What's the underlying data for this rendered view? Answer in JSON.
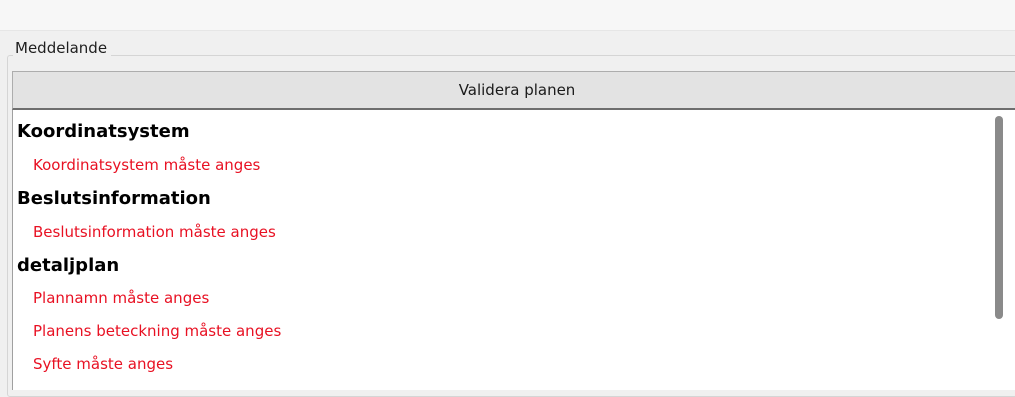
{
  "group": {
    "legend": "Meddelande"
  },
  "toolbar": {
    "validate_label": "Validera planen"
  },
  "messages": {
    "sections": [
      {
        "title": "Koordinatsystem",
        "items": [
          "Koordinatsystem måste anges"
        ]
      },
      {
        "title": "Beslutsinformation",
        "items": [
          "Beslutsinformation måste anges"
        ]
      },
      {
        "title": "detaljplan",
        "items": [
          "Plannamn måste anges",
          "Planens beteckning måste anges",
          "Syfte måste anges"
        ]
      }
    ]
  },
  "colors": {
    "error_text": "#e81123",
    "header_text": "#000000",
    "button_background": "#e3e3e3",
    "window_background": "#f0f0f0",
    "list_background": "#ffffff"
  }
}
